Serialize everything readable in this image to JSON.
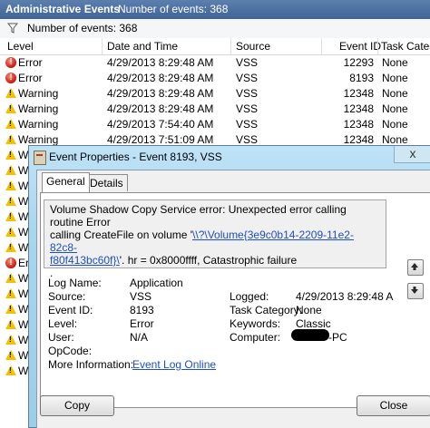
{
  "event_viewer": {
    "title": "Administrative Events",
    "event_count_title": "Number of events: 368",
    "filter_text": "Number of events: 368",
    "columns": [
      "Level",
      "Date and Time",
      "Source",
      "Event ID",
      "Task Categ"
    ],
    "rows": [
      {
        "level": "Error",
        "datetime": "4/29/2013 8:29:48 AM",
        "source": "VSS",
        "event_id": "12293",
        "task": "None"
      },
      {
        "level": "Error",
        "datetime": "4/29/2013 8:29:48 AM",
        "source": "VSS",
        "event_id": "8193",
        "task": "None"
      },
      {
        "level": "Warning",
        "datetime": "4/29/2013 8:29:48 AM",
        "source": "VSS",
        "event_id": "12348",
        "task": "None"
      },
      {
        "level": "Warning",
        "datetime": "4/29/2013 8:29:48 AM",
        "source": "VSS",
        "event_id": "12348",
        "task": "None"
      },
      {
        "level": "Warning",
        "datetime": "4/29/2013 7:54:40 AM",
        "source": "VSS",
        "event_id": "12348",
        "task": "None"
      },
      {
        "level": "Warning",
        "datetime": "4/29/2013 7:51:09 AM",
        "source": "VSS",
        "event_id": "12348",
        "task": "None"
      }
    ],
    "side_rows": [
      "W",
      "W",
      "W",
      "W",
      "W",
      "W",
      "W",
      "Er",
      "W",
      "W",
      "W",
      "W",
      "W",
      "W",
      "W"
    ],
    "colors": {
      "title_bar": "#4a6fa5",
      "error": "#c8150c",
      "warning": "#f2c200"
    }
  },
  "dialog": {
    "title": "Event Properties - Event 8193, VSS",
    "tabs": [
      "General",
      "Details"
    ],
    "active_tab": "General",
    "description": {
      "line1": "Volume Shadow Copy Service error: Unexpected error calling routine Error",
      "line2_prefix": "calling CreateFile on volume '",
      "link_part1": "\\\\?\\Volume{3e9c0b14-2209-11e2-82c8-",
      "link_part2": "f80f413bc60f}\\",
      "line3_suffix": "'.  hr = 0x8000ffff, Catastrophic failure",
      "line4": "."
    },
    "fields": {
      "log_name_label": "Log Name:",
      "log_name": "Application",
      "source_label": "Source:",
      "source": "VSS",
      "event_id_label": "Event ID:",
      "event_id": "8193",
      "level_label": "Level:",
      "level": "Error",
      "user_label": "User:",
      "user": "N/A",
      "opcode_label": "OpCode:",
      "opcode": "",
      "more_info_label": "More Information:",
      "more_info_link": "Event Log Online",
      "logged_label": "Logged:",
      "logged": "4/29/2013 8:29:48 A",
      "task_category_label": "Task Category:",
      "task_category": "None",
      "keywords_label": "Keywords:",
      "keywords": "Classic",
      "computer_label": "Computer:",
      "computer_suffix": "-PC"
    },
    "buttons": {
      "copy": "Copy",
      "close": "Close"
    },
    "close_glyph": "x"
  }
}
